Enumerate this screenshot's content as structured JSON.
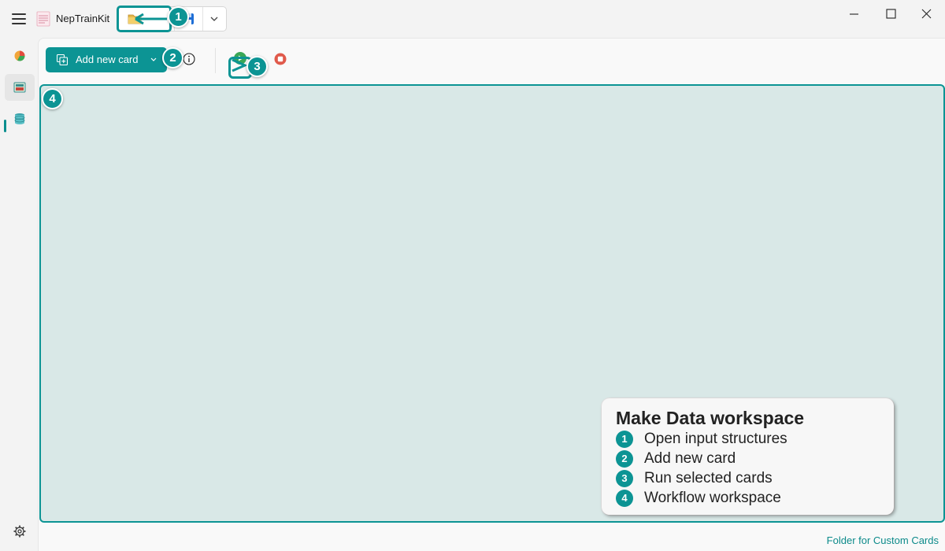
{
  "app": {
    "title": "NepTrainKit"
  },
  "toolbar": {
    "add_card_label": "Add new card"
  },
  "footer": {
    "custom_cards_link": "Folder for Custom Cards"
  },
  "icons": {
    "menu": "hamburger-icon",
    "open": "folder-icon",
    "save": "save-icon",
    "dropdown": "chevron-down-icon",
    "info": "info-icon",
    "run": "play-icon",
    "stop": "stop-icon",
    "settings": "gear-icon",
    "rail_items": [
      "pie-chart-icon",
      "make-data-icon",
      "database-icon"
    ]
  },
  "annotations": {
    "badges": [
      "1",
      "2",
      "3",
      "4"
    ],
    "legend": {
      "title": "Make Data workspace",
      "items": [
        {
          "num": "1",
          "text": "Open input structures"
        },
        {
          "num": "2",
          "text": "Add new card"
        },
        {
          "num": "3",
          "text": "Run selected cards"
        },
        {
          "num": "4",
          "text": "Workflow workspace"
        }
      ]
    }
  },
  "colors": {
    "accent": "#0c9494",
    "workspace_bg": "#d9e8e7",
    "stop": "#e05a4b",
    "link": "#0c8a8a"
  }
}
